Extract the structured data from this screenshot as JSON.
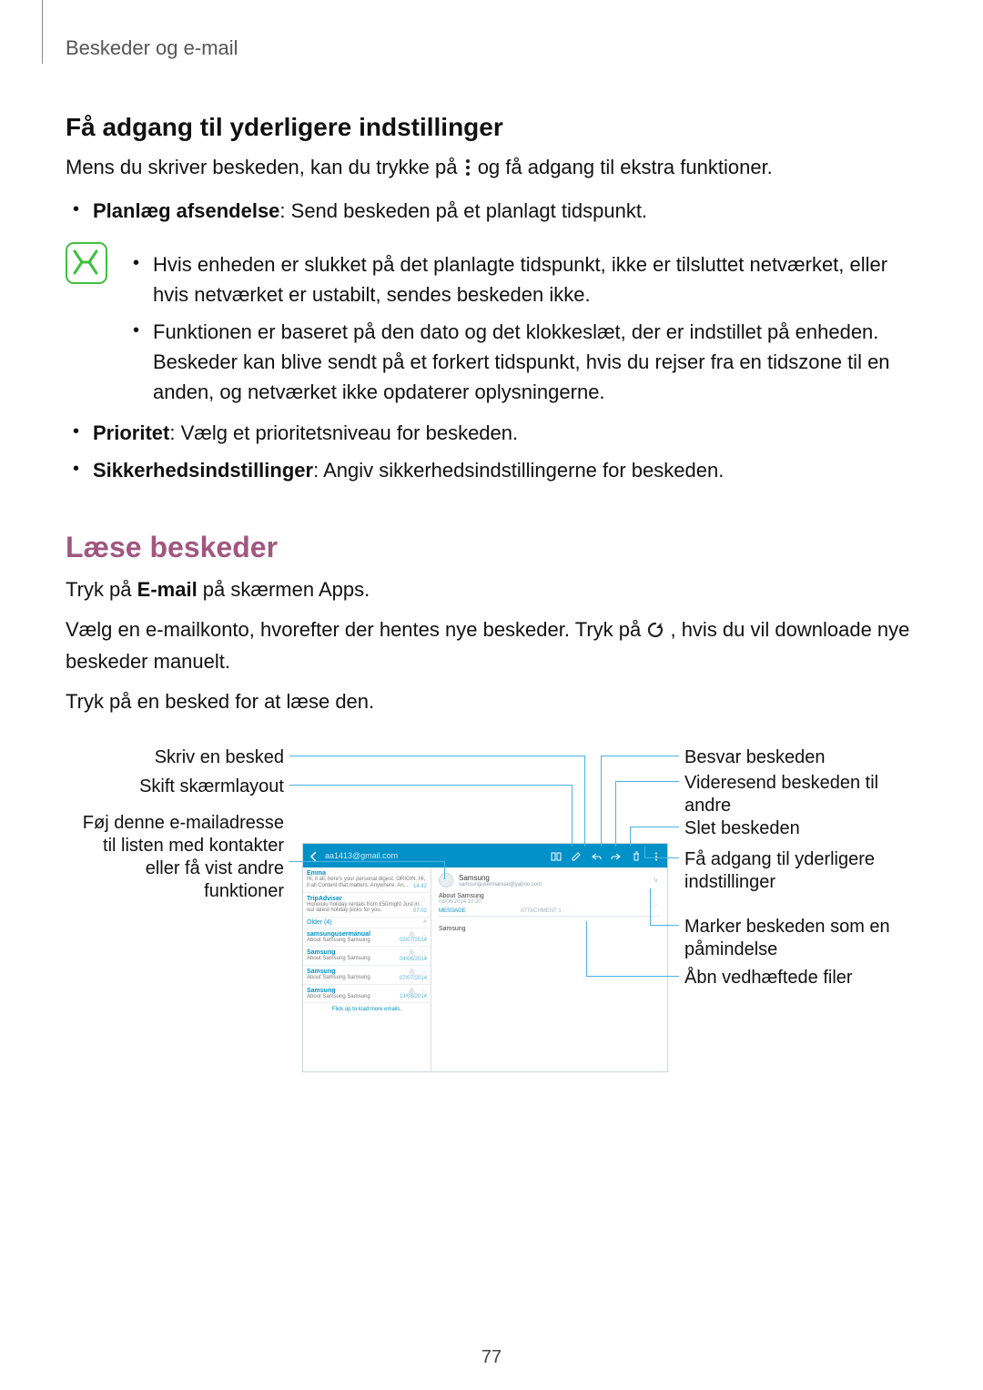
{
  "breadcrumb": "Beskeder og e-mail",
  "h2_1": "Få adgang til yderligere indstillinger",
  "p1_a": "Mens du skriver beskeden, kan du trykke på ",
  "p1_b": " og få adgang til ekstra funktioner.",
  "b1_label": "Planlæg afsendelse",
  "b1_text": ": Send beskeden på et planlagt tidspunkt.",
  "note1": "Hvis enheden er slukket på det planlagte tidspunkt, ikke er tilsluttet netværket, eller hvis netværket er ustabilt, sendes beskeden ikke.",
  "note2": "Funktionen er baseret på den dato og det klokkeslæt, der er indstillet på enheden. Beskeder kan blive sendt på et forkert tidspunkt, hvis du rejser fra en tidszone til en anden, og netværket ikke opdaterer oplysningerne.",
  "b2_label": "Prioritet",
  "b2_text": ": Vælg et prioritetsniveau for beskeden.",
  "b3_label": "Sikkerhedsindstillinger",
  "b3_text": ": Angiv sikkerhedsindstillingerne for beskeden.",
  "section_title": "Læse beskeder",
  "p2_a": "Tryk på ",
  "p2_strong": "E-mail",
  "p2_b": " på skærmen Apps.",
  "p3_a": "Vælg en e-mailkonto, hvorefter der hentes nye beskeder. Tryk på ",
  "p3_b": ", hvis du vil downloade nye beskeder manuelt.",
  "p4": "Tryk på en besked for at læse den.",
  "callouts": {
    "l1": "Skriv en besked",
    "l2": "Skift skærmlayout",
    "l3": "Føj denne e-mailadresse til listen med kontakter eller få vist andre funktioner",
    "r1": "Besvar beskeden",
    "r2": "Videresend beskeden til andre",
    "r3": "Slet beskeden",
    "r4": "Få adgang til yderligere indstillinger",
    "r5": "Marker beskeden som en påmindelse",
    "r6": "Åbn vedhæftede filer"
  },
  "shot": {
    "addr": "aa1413@gmail.com",
    "list": {
      "i1": {
        "snd": "Emma",
        "sub": "Hi, it all, here's your personal digest. ORIGIN. Hi, it all Content that matters. Anywhere. An...",
        "time": "14:42"
      },
      "i2": {
        "snd": "TripAdvisor",
        "sub": "Honolulu holiday rentals from £50/night Just in: our latest holiday picks for you.",
        "time": "07:02"
      },
      "sep": "Older (4)",
      "i3": {
        "snd": "samsungusermanual",
        "sub": "About Samsung\nSamsung",
        "time": "",
        "date": "02/07/2014"
      },
      "i4": {
        "snd": "Samsung",
        "sub": "About Samsung\nSamsung",
        "date": "04/06/2014"
      },
      "i5": {
        "snd": "Samsung",
        "sub": "About Samsung\nSamsung",
        "date": "07/07/2014"
      },
      "i6": {
        "snd": "Samsung",
        "sub": "About Samsung\nSamsung",
        "date": "13/05/2014"
      },
      "foot": "Flick up to load more emails."
    },
    "view": {
      "from": "Samsung",
      "addr": "samsungusermanual@yahoo.com",
      "subj": "About Samsung",
      "date": "05/06/2014 10:20",
      "tab1": "MESSAGE",
      "tab2": "ATTACHMENT 1",
      "body": "Samsung"
    }
  },
  "page_number": "77"
}
